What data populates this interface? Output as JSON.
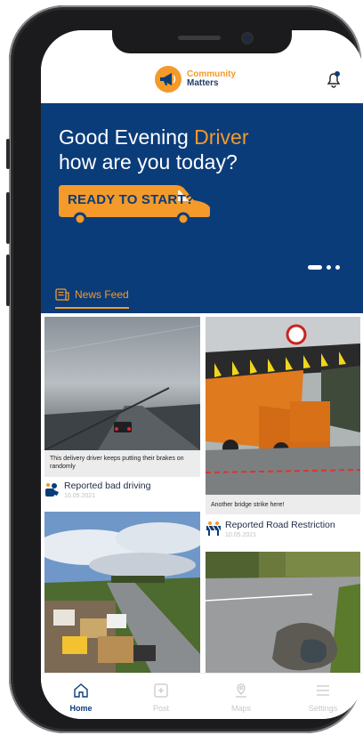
{
  "brand": {
    "line1": "Community",
    "line2": "Matters"
  },
  "hero": {
    "greeting_prefix": "Good Evening ",
    "user_name": "Driver",
    "greeting_line2": "how are you today?",
    "cta_label": "READY TO START?",
    "carousel_total": 3,
    "carousel_active": 1
  },
  "feed": {
    "tab_label": "News Feed",
    "posts": [
      {
        "caption": "This delivery driver keeps putting their brakes on randomly",
        "title": "Reported bad driving",
        "date": "10.05.2021",
        "icon": "driver-report-icon"
      },
      {
        "caption": "Another bridge strike here!",
        "title": "Reported Road Restriction",
        "date": "10.05.2021",
        "icon": "road-barrier-icon"
      },
      {
        "caption": "",
        "title": "",
        "date": "",
        "icon": "fly-tipping-photo"
      },
      {
        "caption": "",
        "title": "",
        "date": "",
        "icon": "pothole-photo"
      }
    ]
  },
  "tabbar": {
    "items": [
      {
        "label": "Home",
        "icon": "home-icon",
        "active": true
      },
      {
        "label": "Post",
        "icon": "plus-square-icon",
        "active": false
      },
      {
        "label": "Maps",
        "icon": "map-pin-icon",
        "active": false
      },
      {
        "label": "Settings",
        "icon": "menu-icon",
        "active": false
      }
    ]
  },
  "colors": {
    "brand_blue": "#0b3c7a",
    "accent_orange": "#f39a2a"
  }
}
